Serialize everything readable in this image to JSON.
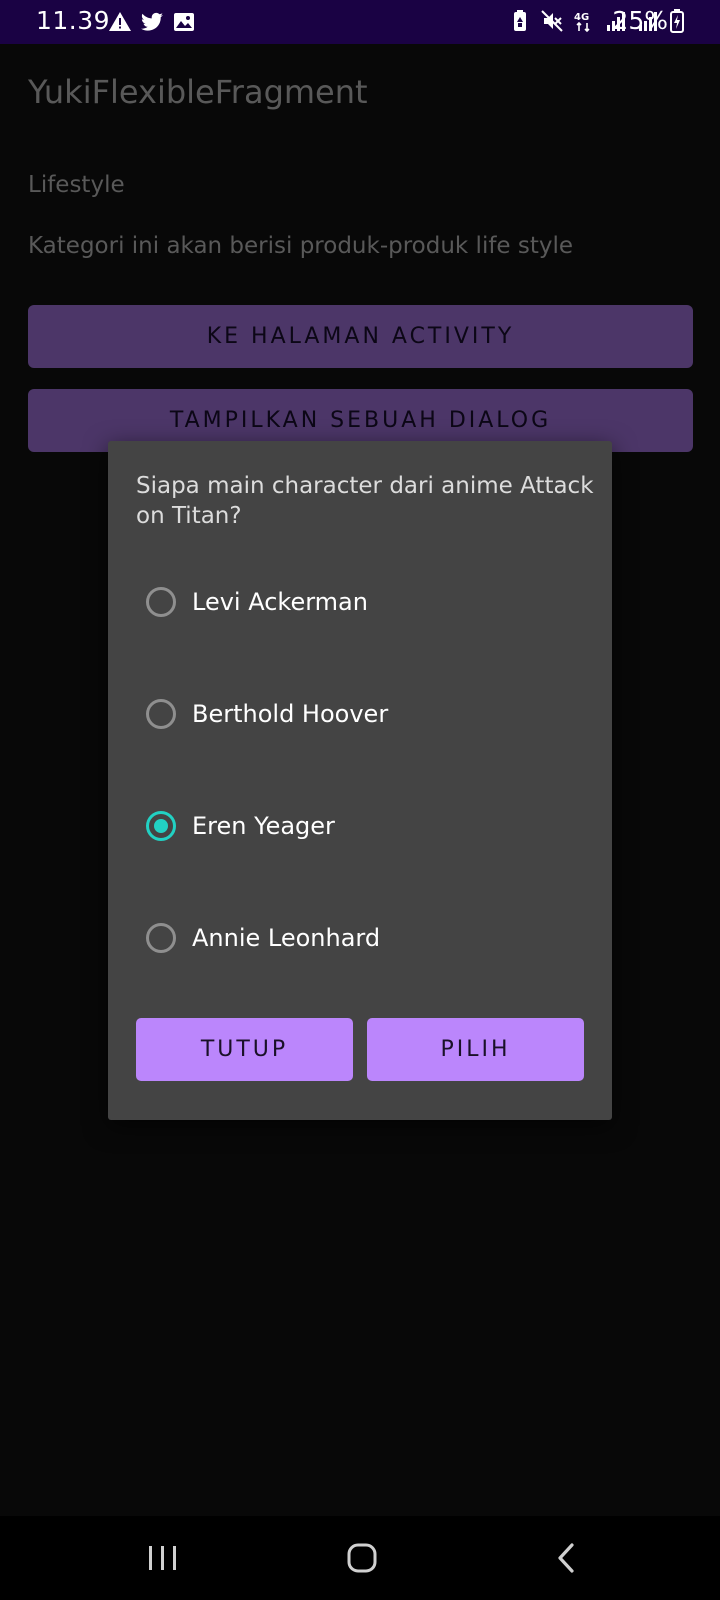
{
  "status_bar": {
    "time": "11.39",
    "battery": "25%",
    "left_icons": [
      "warning-icon",
      "twitter-icon",
      "image-icon"
    ],
    "right_icons": [
      "battery-saver-icon",
      "mute-icon",
      "4g-icon",
      "signal-icon",
      "signal-icon"
    ]
  },
  "app": {
    "title": "YukiFlexibleFragment",
    "category_title": "Lifestyle",
    "category_description": "Kategori ini akan berisi produk-produk life style",
    "button_activity": "KE HALAMAN ACTIVITY",
    "button_dialog": "TAMPILKAN SEBUAH DIALOG"
  },
  "dialog": {
    "question": "Siapa main character dari anime Attack on Titan?",
    "options": [
      {
        "label": "Levi Ackerman",
        "checked": false
      },
      {
        "label": "Berthold Hoover",
        "checked": false
      },
      {
        "label": "Eren Yeager",
        "checked": true
      },
      {
        "label": "Annie Leonhard",
        "checked": false
      }
    ],
    "close_label": "TUTUP",
    "choose_label": "PILIH"
  },
  "colors": {
    "status_bar": "#1a0244",
    "accent": "#bb86fc",
    "radio_checked": "#22d1c3",
    "dialog_bg": "#444444"
  },
  "nav_bar": {
    "icons": [
      "recents-icon",
      "home-icon",
      "back-icon"
    ]
  }
}
